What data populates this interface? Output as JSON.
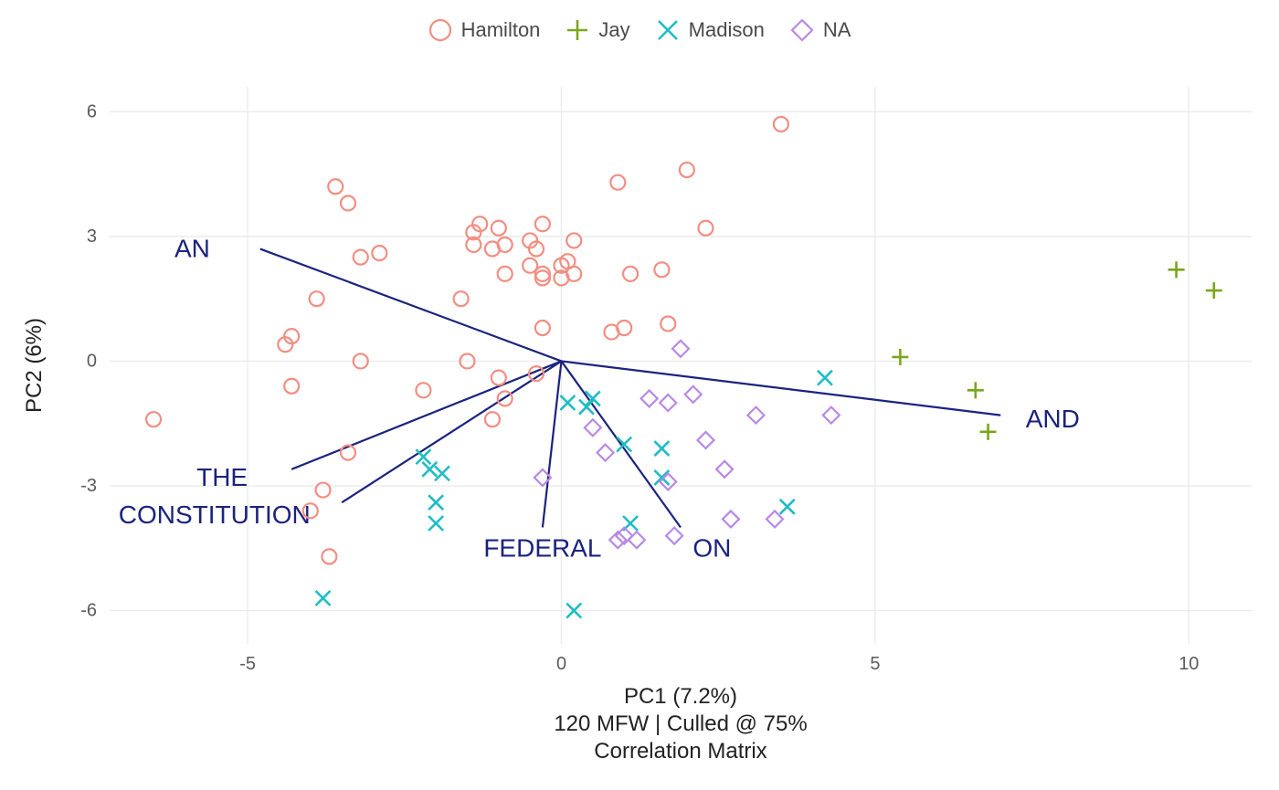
{
  "legend": {
    "items": [
      {
        "key": "hamilton",
        "label": "Hamilton",
        "marker": "circle",
        "color": "#f28e82"
      },
      {
        "key": "jay",
        "label": "Jay",
        "marker": "plus",
        "color": "#7aa61d"
      },
      {
        "key": "madison",
        "label": "Madison",
        "marker": "cross",
        "color": "#1fbdc4"
      },
      {
        "key": "na",
        "label": "NA",
        "marker": "diamond",
        "color": "#b88ae6"
      }
    ]
  },
  "axes": {
    "x": {
      "label": "PC1 (7.2%)",
      "ticks": [
        -5,
        0,
        5,
        10
      ],
      "domain": [
        -7.2,
        11.0
      ]
    },
    "y": {
      "label": "PC2 (6%)",
      "ticks": [
        -6,
        -3,
        0,
        3,
        6
      ],
      "domain": [
        -6.8,
        6.6
      ]
    }
  },
  "captions": {
    "line1": "120 MFW | Culled @ 75%",
    "line2": "Correlation Matrix"
  },
  "chart_data": {
    "type": "scatter",
    "title": "",
    "xlabel": "PC1 (7.2%)",
    "ylabel": "PC2 (6%)",
    "xlim": [
      -7.2,
      11.0
    ],
    "ylim": [
      -6.8,
      6.6
    ],
    "legend_position": "top",
    "grid": true,
    "loadings": [
      {
        "label": "AN",
        "x": -4.8,
        "y": 2.7,
        "label_x": -5.6,
        "label_y": 2.7,
        "anchor": "end"
      },
      {
        "label": "AND",
        "x": 7.0,
        "y": -1.3,
        "label_x": 7.4,
        "label_y": -1.4,
        "anchor": "start"
      },
      {
        "label": "THE",
        "x": -4.3,
        "y": -2.6,
        "label_x": -5.0,
        "label_y": -2.8,
        "anchor": "end"
      },
      {
        "label": "CONSTITUTION",
        "x": -3.5,
        "y": -3.4,
        "label_x": -4.0,
        "label_y": -3.7,
        "anchor": "end"
      },
      {
        "label": "FEDERAL",
        "x": -0.3,
        "y": -4.0,
        "label_x": -0.3,
        "label_y": -4.5,
        "anchor": "middle"
      },
      {
        "label": "ON",
        "x": 1.9,
        "y": -4.0,
        "label_x": 2.4,
        "label_y": -4.5,
        "anchor": "middle"
      }
    ],
    "series": [
      {
        "name": "Hamilton",
        "marker": "circle",
        "color": "#f28e82",
        "points": [
          [
            -6.5,
            -1.4
          ],
          [
            -4.3,
            0.6
          ],
          [
            -4.4,
            0.4
          ],
          [
            -4.3,
            -0.6
          ],
          [
            -3.9,
            1.5
          ],
          [
            -3.8,
            -3.1
          ],
          [
            -4.0,
            -3.6
          ],
          [
            -3.6,
            4.2
          ],
          [
            -3.4,
            3.8
          ],
          [
            -3.2,
            2.5
          ],
          [
            -2.9,
            2.6
          ],
          [
            -3.2,
            0.0
          ],
          [
            -3.4,
            -2.2
          ],
          [
            -3.7,
            -4.7
          ],
          [
            -2.2,
            -0.7
          ],
          [
            -1.6,
            1.5
          ],
          [
            -1.5,
            0.0
          ],
          [
            -1.4,
            3.1
          ],
          [
            -1.3,
            3.3
          ],
          [
            -1.4,
            2.8
          ],
          [
            -1.1,
            2.7
          ],
          [
            -1.0,
            3.2
          ],
          [
            -0.9,
            2.1
          ],
          [
            -0.9,
            2.8
          ],
          [
            -1.0,
            -0.4
          ],
          [
            -0.9,
            -0.9
          ],
          [
            -1.1,
            -1.4
          ],
          [
            -0.5,
            2.3
          ],
          [
            -0.5,
            2.9
          ],
          [
            -0.4,
            2.7
          ],
          [
            -0.3,
            3.3
          ],
          [
            -0.3,
            2.1
          ],
          [
            -0.3,
            2.0
          ],
          [
            -0.3,
            0.8
          ],
          [
            -0.4,
            -0.3
          ],
          [
            0.0,
            2.3
          ],
          [
            0.0,
            2.0
          ],
          [
            0.1,
            2.4
          ],
          [
            0.2,
            2.1
          ],
          [
            0.2,
            2.9
          ],
          [
            0.8,
            0.7
          ],
          [
            0.9,
            4.3
          ],
          [
            1.0,
            0.8
          ],
          [
            1.1,
            2.1
          ],
          [
            1.6,
            2.2
          ],
          [
            1.7,
            0.9
          ],
          [
            2.0,
            4.6
          ],
          [
            2.3,
            3.2
          ],
          [
            3.5,
            5.7
          ]
        ]
      },
      {
        "name": "Jay",
        "marker": "plus",
        "color": "#7aa61d",
        "points": [
          [
            5.4,
            0.1
          ],
          [
            6.6,
            -0.7
          ],
          [
            6.8,
            -1.7
          ],
          [
            9.8,
            2.2
          ],
          [
            10.4,
            1.7
          ]
        ]
      },
      {
        "name": "Madison",
        "marker": "cross",
        "color": "#1fbdc4",
        "points": [
          [
            -3.8,
            -5.7
          ],
          [
            -2.2,
            -2.3
          ],
          [
            -2.1,
            -2.6
          ],
          [
            -2.0,
            -3.4
          ],
          [
            -2.0,
            -3.9
          ],
          [
            -1.9,
            -2.7
          ],
          [
            0.1,
            -1.0
          ],
          [
            0.2,
            -6.0
          ],
          [
            0.4,
            -1.1
          ],
          [
            0.5,
            -0.9
          ],
          [
            1.0,
            -2.0
          ],
          [
            1.1,
            -3.9
          ],
          [
            1.6,
            -2.1
          ],
          [
            1.6,
            -2.8
          ],
          [
            3.6,
            -3.5
          ],
          [
            4.2,
            -0.4
          ]
        ]
      },
      {
        "name": "NA",
        "marker": "diamond",
        "color": "#b88ae6",
        "points": [
          [
            -0.3,
            -2.8
          ],
          [
            0.5,
            -1.6
          ],
          [
            0.7,
            -2.2
          ],
          [
            0.9,
            -4.3
          ],
          [
            1.0,
            -4.2
          ],
          [
            1.2,
            -4.3
          ],
          [
            1.4,
            -0.9
          ],
          [
            1.7,
            -1.0
          ],
          [
            1.7,
            -2.9
          ],
          [
            1.8,
            -4.2
          ],
          [
            1.9,
            0.3
          ],
          [
            2.1,
            -0.8
          ],
          [
            2.3,
            -1.9
          ],
          [
            2.6,
            -2.6
          ],
          [
            2.7,
            -3.8
          ],
          [
            3.1,
            -1.3
          ],
          [
            3.4,
            -3.8
          ],
          [
            4.3,
            -1.3
          ]
        ]
      }
    ]
  }
}
